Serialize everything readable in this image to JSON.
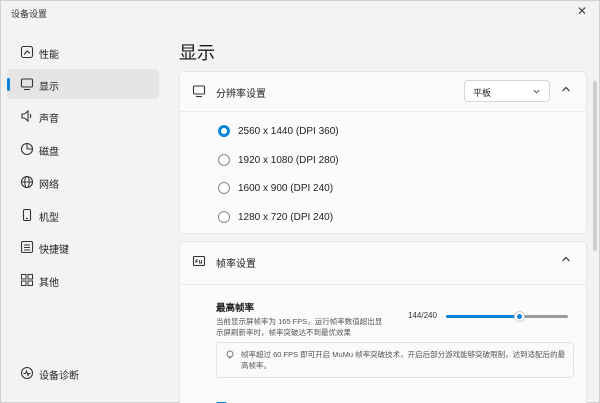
{
  "window": {
    "title": "设备设置"
  },
  "sidebar": {
    "items": [
      {
        "label": "性能",
        "icon": "performance-icon"
      },
      {
        "label": "显示",
        "icon": "display-icon",
        "active": true
      },
      {
        "label": "声音",
        "icon": "speaker-icon"
      },
      {
        "label": "磁盘",
        "icon": "disk-icon"
      },
      {
        "label": "网络",
        "icon": "globe-icon"
      },
      {
        "label": "机型",
        "icon": "phone-icon"
      },
      {
        "label": "快捷键",
        "icon": "keyboard-icon"
      },
      {
        "label": "其他",
        "icon": "grid-icon"
      }
    ],
    "footer": {
      "label": "设备诊断",
      "icon": "diagnostics-icon"
    }
  },
  "main": {
    "title": "显示",
    "resolution": {
      "label": "分辨率设置",
      "mode_value": "平板",
      "options": [
        {
          "label": "2560 x 1440 (DPI 360)",
          "checked": true
        },
        {
          "label": "1920 x 1080 (DPI 280)",
          "checked": false
        },
        {
          "label": "1600 x 900 (DPI 240)",
          "checked": false
        },
        {
          "label": "1280 x 720 (DPI 240)",
          "checked": false
        }
      ]
    },
    "framerate": {
      "label": "帧率设置",
      "max_title": "最高帧率",
      "description": "当前显示屏帧率为 165 FPS，运行帧率数值超出显示屏刷新率时，帧率突破达不到最优效果",
      "slider_value_text": "144/240",
      "slider_value": 144,
      "slider_max": 240,
      "tip": "帧率超过 60 FPS 即可开启 MuMu 帧率突破技术，开启后部分游戏能够突破限制，达到适配后的最高帧率。"
    }
  },
  "colors": {
    "accent": "#0a84d6"
  }
}
